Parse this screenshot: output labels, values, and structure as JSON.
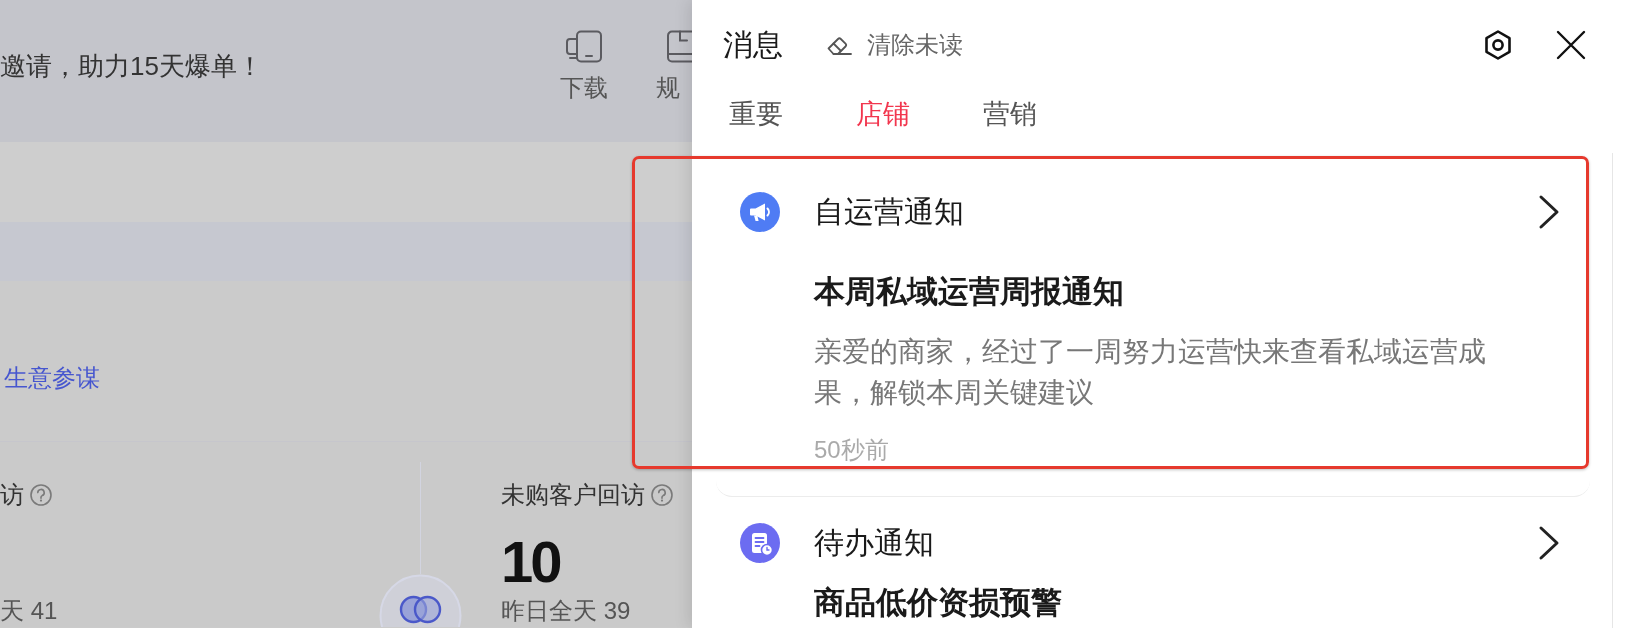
{
  "backdrop": {
    "banner": "邀请，助力15天爆单！",
    "tools": [
      {
        "kind": "download",
        "label": "下载"
      },
      {
        "kind": "rules",
        "label": "规"
      }
    ],
    "link": "生意参谋",
    "stats": [
      {
        "label": "访",
        "footer": "天 41"
      },
      {
        "label": "未购客户回访",
        "value": "10",
        "footer": "昨日全天 39"
      }
    ]
  },
  "panel": {
    "title": "消息",
    "clear_label": "清除未读",
    "tabs": [
      {
        "label": "重要",
        "selected": false
      },
      {
        "label": "店铺",
        "selected": true
      },
      {
        "label": "营销",
        "selected": false
      }
    ],
    "notices": [
      {
        "kind": "megaphone",
        "color": "#4f7cf4",
        "category": "自运营通知",
        "title": "本周私域运营周报通知",
        "body": "亲爱的商家，经过了一周努力运营快来查看私域运营成果，解锁本周关键建议",
        "time": "50秒前",
        "highlighted": true
      },
      {
        "kind": "todo",
        "color": "#6c6cf1",
        "category": "待办通知",
        "title": "商品低价资损预警",
        "highlighted": false
      }
    ]
  }
}
